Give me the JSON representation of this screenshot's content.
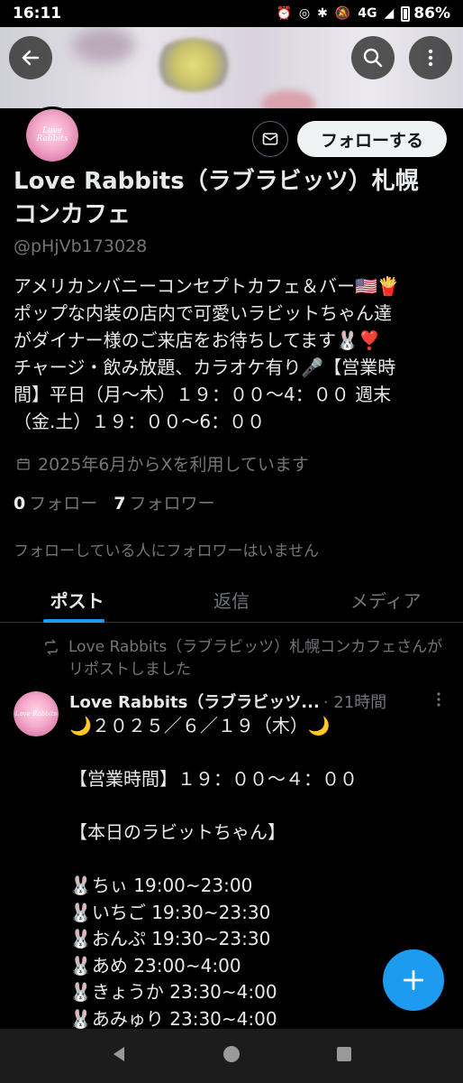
{
  "status_bar": {
    "time": "16:11",
    "network": "4G",
    "battery": "86%"
  },
  "profile": {
    "avatar_logo_text": "Love Rabbits",
    "follow_label": "フォローする",
    "display_name": "Love Rabbits（ラブラビッツ）札幌コンカフェ",
    "handle": "@pHjVb173028",
    "bio_lines": [
      "アメリカンバニーコンセプトカフェ＆バー🇺🇸🍟",
      "ポップな内装の店内で可愛いラビットちゃん達",
      "がダイナー様のご来店をお待ちしてます🐰❣️",
      "チャージ・飲み放題、カラオケ有り🎤【営業時",
      "間】平日（月〜木）１９：００〜4：００ 週末",
      "（金.土）１９：００〜6：００"
    ],
    "joined": "2025年6月からXを利用しています",
    "following_count": "0",
    "following_label": "フォロー",
    "followers_count": "7",
    "followers_label": "フォロワー",
    "followed_by_note": "フォローしている人にフォロワーはいません"
  },
  "tabs": [
    {
      "label": "ポスト",
      "active": true
    },
    {
      "label": "返信",
      "active": false
    },
    {
      "label": "メディア",
      "active": false
    }
  ],
  "post": {
    "repost_notice": "Love Rabbits（ラブラビッツ）札幌コンカフェさんがリポストしました",
    "author": "Love Rabbits（ラブラビッツ...",
    "time": "· 21時間",
    "lines": [
      "🌙２０２５／６／１９（木）🌙",
      "",
      "【営業時間】１９：００〜４：００",
      "",
      "【本日のラビットちゃん】",
      "",
      "🐰ちぃ 19:00~23:00",
      "🐰いちご 19:30~23:30",
      "🐰おんぷ 19:30~23:30",
      "🐰あめ 23:00~4:00",
      "🐰きょうか 23:30~4:00",
      "🐰あみゅり 23:30~4:00"
    ]
  },
  "colors": {
    "accent": "#1d9bf0",
    "background": "#000000",
    "text_primary": "#e7e9ea",
    "text_secondary": "#71767b"
  }
}
